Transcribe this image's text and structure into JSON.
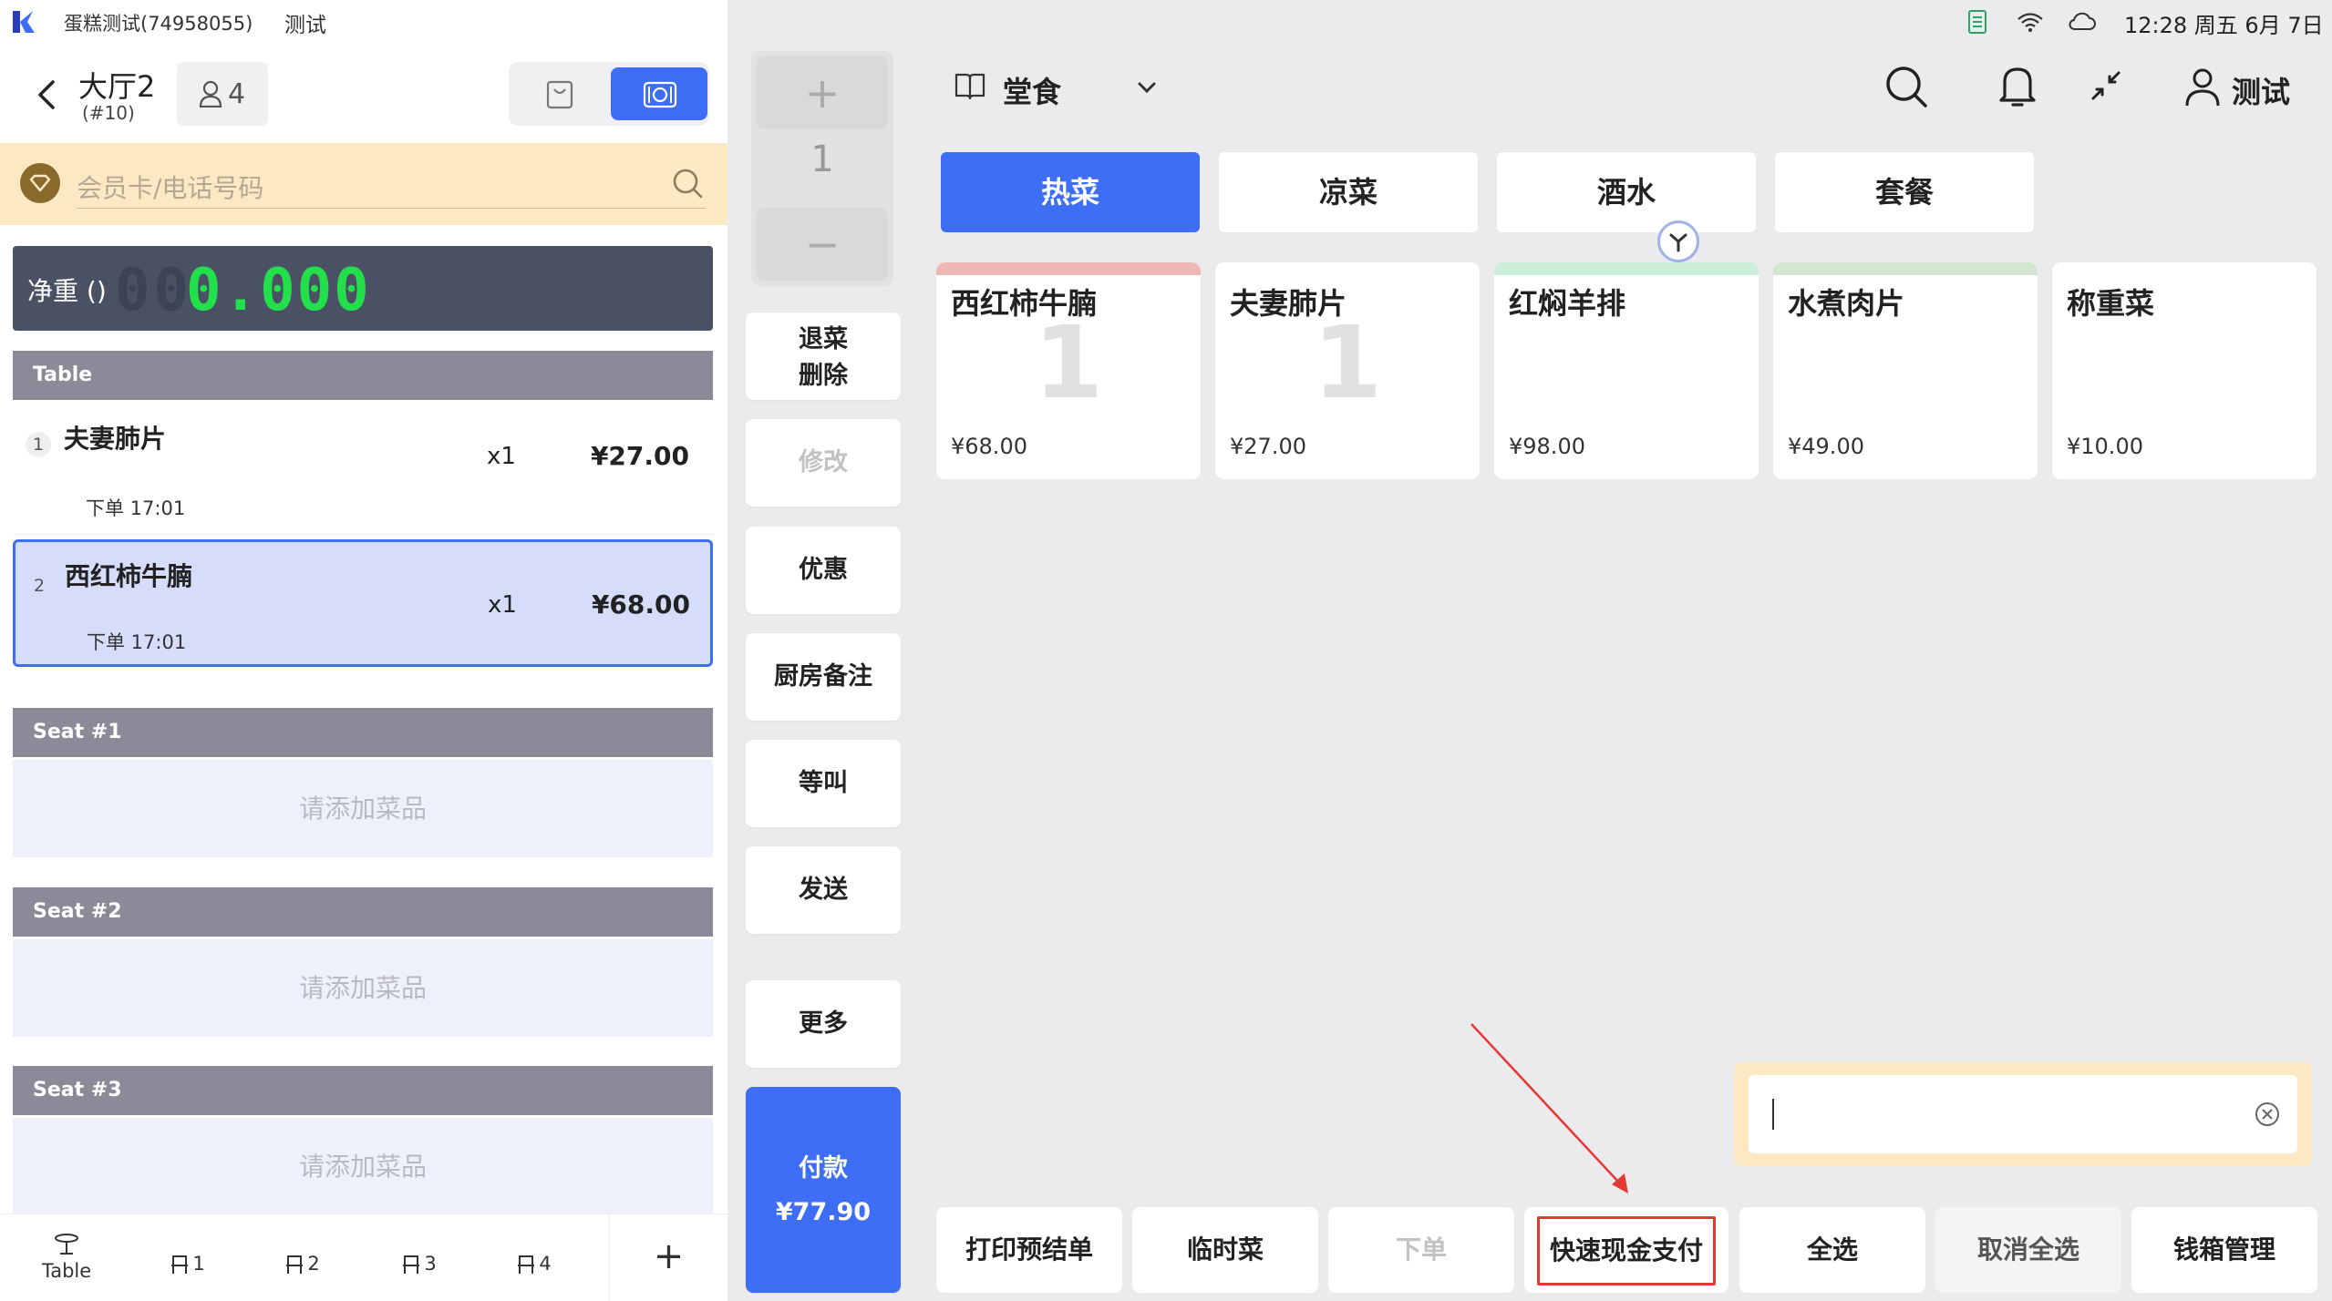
{
  "statusbar": {
    "store_name": "蛋糕测试(74958055)",
    "user": "测试",
    "clock": "12:28 周五 6月 7日"
  },
  "header": {
    "table_name": "大厅2",
    "table_no": "(#10)",
    "guest_count": "4"
  },
  "member": {
    "placeholder": "会员卡/电话号码"
  },
  "scale": {
    "label": "净重 ()",
    "value": "0.000"
  },
  "sections": {
    "table": "Table",
    "seat1": "Seat #1",
    "seat2": "Seat #2",
    "seat3": "Seat #3",
    "empty_hint": "请添加菜品"
  },
  "order_items": [
    {
      "index": "1",
      "name": "夫妻肺片",
      "qty": "x1",
      "price": "¥27.00",
      "time": "下单 17:01"
    },
    {
      "index": "2",
      "name": "西红柿牛腩",
      "qty": "x1",
      "price": "¥68.00",
      "time": "下单 17:01"
    }
  ],
  "seat_tabs": {
    "table": "Table",
    "s1": "1",
    "s2": "2",
    "s3": "3",
    "s4": "4",
    "add": "+"
  },
  "middle": {
    "plus": "+",
    "count": "1",
    "minus": "−",
    "refund": "退菜",
    "delete": "删除",
    "modify": "修改",
    "discount": "优惠",
    "kitchen_note": "厨房备注",
    "hold": "等叫",
    "send": "发送",
    "more": "更多",
    "pay_label": "付款",
    "pay_amount": "¥77.90"
  },
  "right_header": {
    "mode": "堂食",
    "user": "测试"
  },
  "categories": [
    "热菜",
    "凉菜",
    "酒水",
    "套餐"
  ],
  "dishes": [
    {
      "name": "西红柿牛腩",
      "qty": "1",
      "price": "¥68.00",
      "strip": "#f0b7b7"
    },
    {
      "name": "夫妻肺片",
      "qty": "1",
      "price": "¥27.00",
      "strip": "#ffffff"
    },
    {
      "name": "红焖羊排",
      "qty": "",
      "price": "¥98.00",
      "strip": "#cdeed8"
    },
    {
      "name": "水煮肉片",
      "qty": "",
      "price": "¥49.00",
      "strip": "#d3e6cf"
    },
    {
      "name": "称重菜",
      "qty": "",
      "price": "¥10.00",
      "strip": "#ffffff"
    }
  ],
  "input_box": {
    "value": ""
  },
  "bottom_buttons": {
    "print_prebill": "打印预结单",
    "temp_dish": "临时菜",
    "place_order": "下单",
    "quick_cash": "快速现金支付",
    "select_all": "全选",
    "deselect_all": "取消全选",
    "cash_drawer": "钱箱管理"
  },
  "colors": {
    "accent": "#3e6ef5",
    "highlight_bg": "#d5ddfb",
    "annotation": "#e53935"
  }
}
